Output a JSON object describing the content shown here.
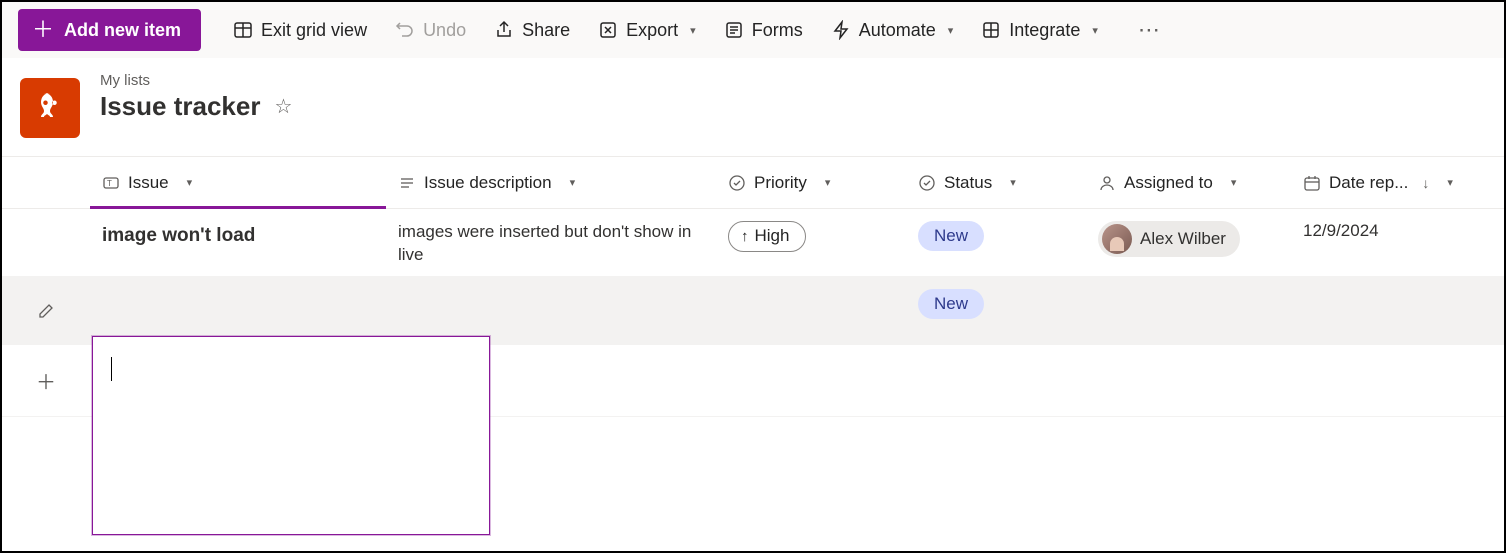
{
  "toolbar": {
    "add_label": "Add new item",
    "exit_grid_label": "Exit grid view",
    "undo_label": "Undo",
    "share_label": "Share",
    "export_label": "Export",
    "forms_label": "Forms",
    "automate_label": "Automate",
    "integrate_label": "Integrate"
  },
  "header": {
    "breadcrumb": "My lists",
    "title": "Issue tracker"
  },
  "columns": {
    "issue": "Issue",
    "description": "Issue description",
    "priority": "Priority",
    "status": "Status",
    "assigned": "Assigned to",
    "date": "Date rep..."
  },
  "rows": [
    {
      "issue": "image won't load",
      "description": "images were inserted but don't show in live",
      "priority": "High",
      "status": "New",
      "assigned": "Alex Wilber",
      "date": "12/9/2024"
    },
    {
      "issue": "",
      "description": "",
      "priority": "",
      "status": "New",
      "assigned": "",
      "date": ""
    }
  ]
}
